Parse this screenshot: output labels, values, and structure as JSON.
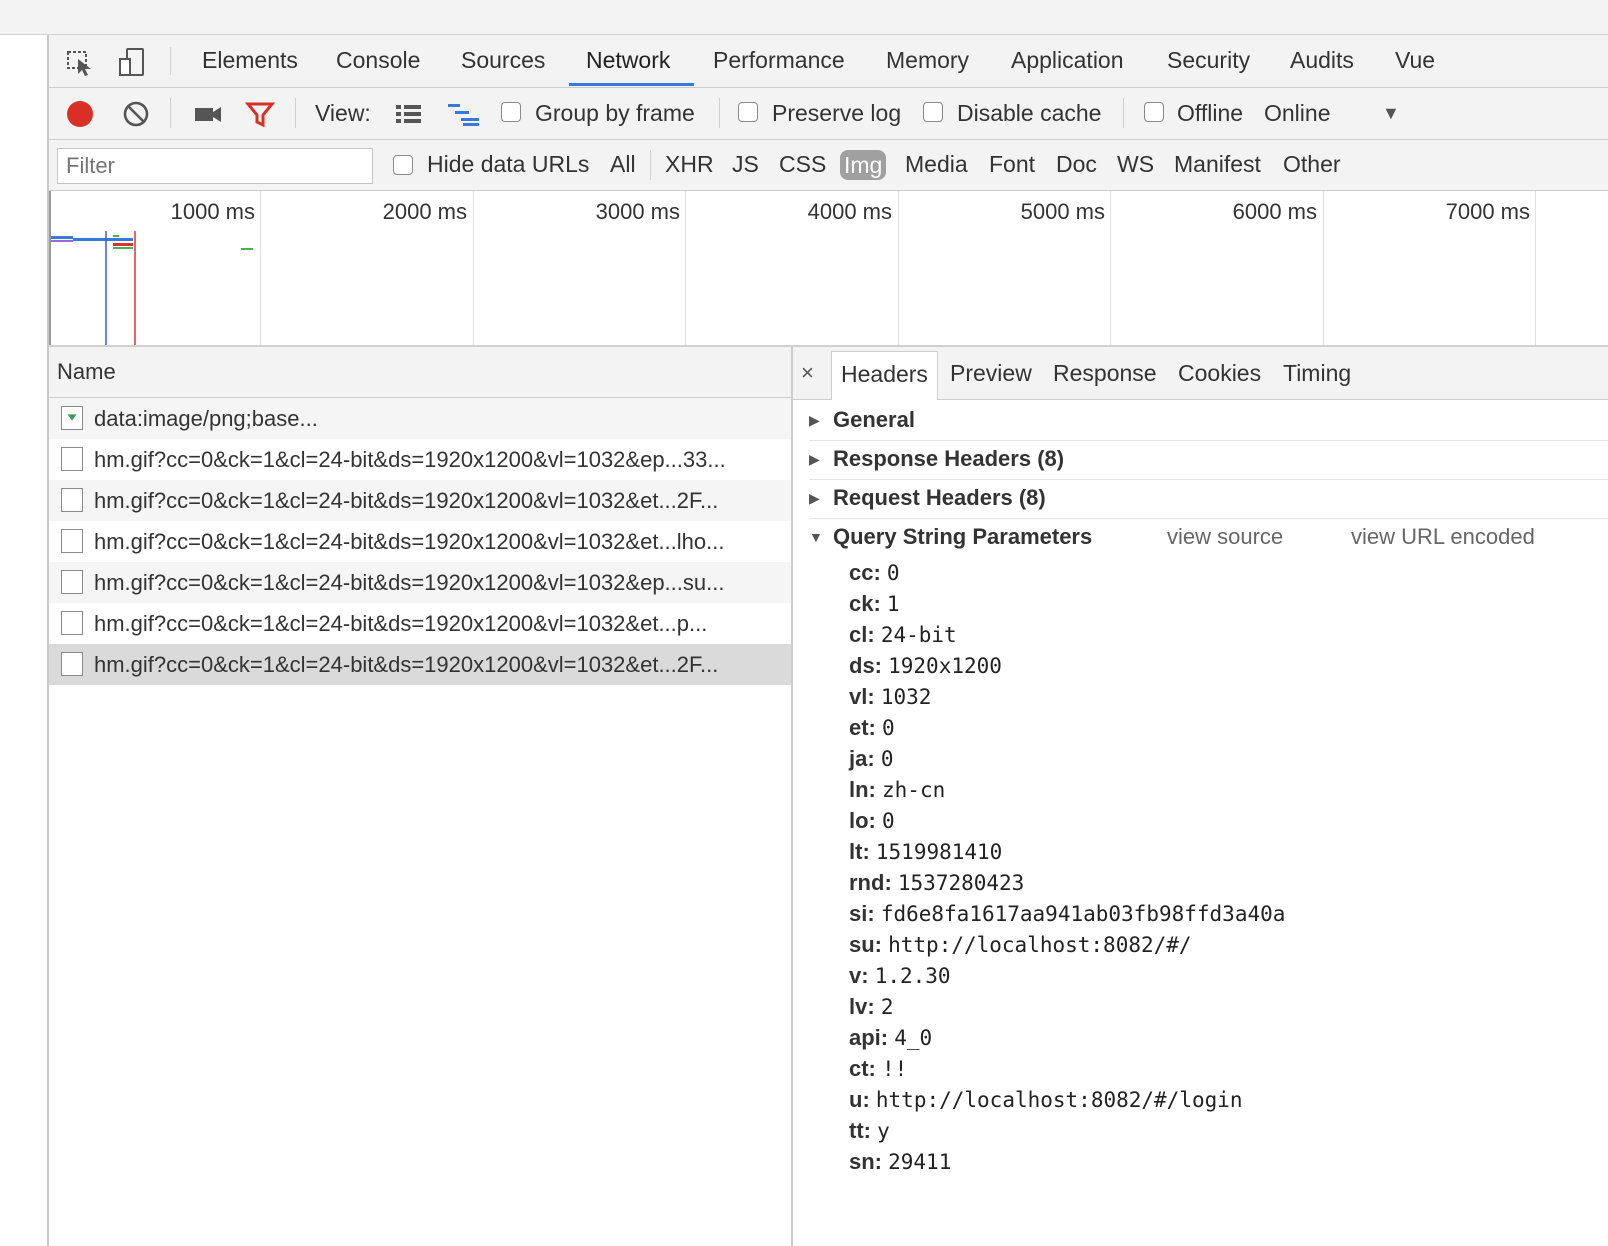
{
  "tabs": [
    {
      "label": "Elements"
    },
    {
      "label": "Console"
    },
    {
      "label": "Sources"
    },
    {
      "label": "Network"
    },
    {
      "label": "Performance"
    },
    {
      "label": "Memory"
    },
    {
      "label": "Application"
    },
    {
      "label": "Security"
    },
    {
      "label": "Audits"
    },
    {
      "label": "Vue"
    }
  ],
  "active_tab": "Network",
  "toolbar": {
    "view_label": "View:",
    "group_by_frame": "Group by frame",
    "preserve_log": "Preserve log",
    "disable_cache": "Disable cache",
    "offline": "Offline",
    "throttle": "Online",
    "record_color": "#d93025",
    "filter_icon_color": "#d93025"
  },
  "filterbar": {
    "placeholder": "Filter",
    "hide_data_urls": "Hide data URLs",
    "types": [
      "All",
      "XHR",
      "JS",
      "CSS",
      "Img",
      "Media",
      "Font",
      "Doc",
      "WS",
      "Manifest",
      "Other"
    ],
    "active_type": "Img"
  },
  "overview": {
    "ticks": [
      "1000 ms",
      "2000 ms",
      "3000 ms",
      "4000 ms",
      "5000 ms",
      "6000 ms",
      "7000 ms"
    ]
  },
  "requests": {
    "header": "Name",
    "rows": [
      {
        "name": "data:image/png;base..."
      },
      {
        "name": "hm.gif?cc=0&ck=1&cl=24-bit&ds=1920x1200&vl=1032&ep...33..."
      },
      {
        "name": "hm.gif?cc=0&ck=1&cl=24-bit&ds=1920x1200&vl=1032&et...2F..."
      },
      {
        "name": "hm.gif?cc=0&ck=1&cl=24-bit&ds=1920x1200&vl=1032&et...lho..."
      },
      {
        "name": "hm.gif?cc=0&ck=1&cl=24-bit&ds=1920x1200&vl=1032&ep...su..."
      },
      {
        "name": "hm.gif?cc=0&ck=1&cl=24-bit&ds=1920x1200&vl=1032&et...p..."
      },
      {
        "name": "hm.gif?cc=0&ck=1&cl=24-bit&ds=1920x1200&vl=1032&et...2F..."
      }
    ]
  },
  "detail": {
    "close": "×",
    "tabs": [
      "Headers",
      "Preview",
      "Response",
      "Cookies",
      "Timing"
    ],
    "active_tab": "Headers",
    "sections": {
      "general": "General",
      "response_headers": "Response Headers (8)",
      "request_headers": "Request Headers (8)",
      "query_string": "Query String Parameters"
    },
    "view_source": "view source",
    "view_url_encoded": "view URL encoded",
    "params": [
      {
        "key": "cc:",
        "value": "0"
      },
      {
        "key": "ck:",
        "value": "1"
      },
      {
        "key": "cl:",
        "value": "24-bit"
      },
      {
        "key": "ds:",
        "value": "1920x1200"
      },
      {
        "key": "vl:",
        "value": "1032"
      },
      {
        "key": "et:",
        "value": "0"
      },
      {
        "key": "ja:",
        "value": "0"
      },
      {
        "key": "ln:",
        "value": "zh-cn"
      },
      {
        "key": "lo:",
        "value": "0"
      },
      {
        "key": "lt:",
        "value": "1519981410"
      },
      {
        "key": "rnd:",
        "value": "1537280423"
      },
      {
        "key": "si:",
        "value": "fd6e8fa1617aa941ab03fb98ffd3a40a"
      },
      {
        "key": "su:",
        "value": "http://localhost:8082/#/"
      },
      {
        "key": "v:",
        "value": "1.2.30"
      },
      {
        "key": "lv:",
        "value": "2"
      },
      {
        "key": "api:",
        "value": "4_0"
      },
      {
        "key": "ct:",
        "value": "!!"
      },
      {
        "key": "u:",
        "value": "http://localhost:8082/#/login"
      },
      {
        "key": "tt:",
        "value": "y"
      },
      {
        "key": "sn:",
        "value": "29411"
      }
    ]
  }
}
